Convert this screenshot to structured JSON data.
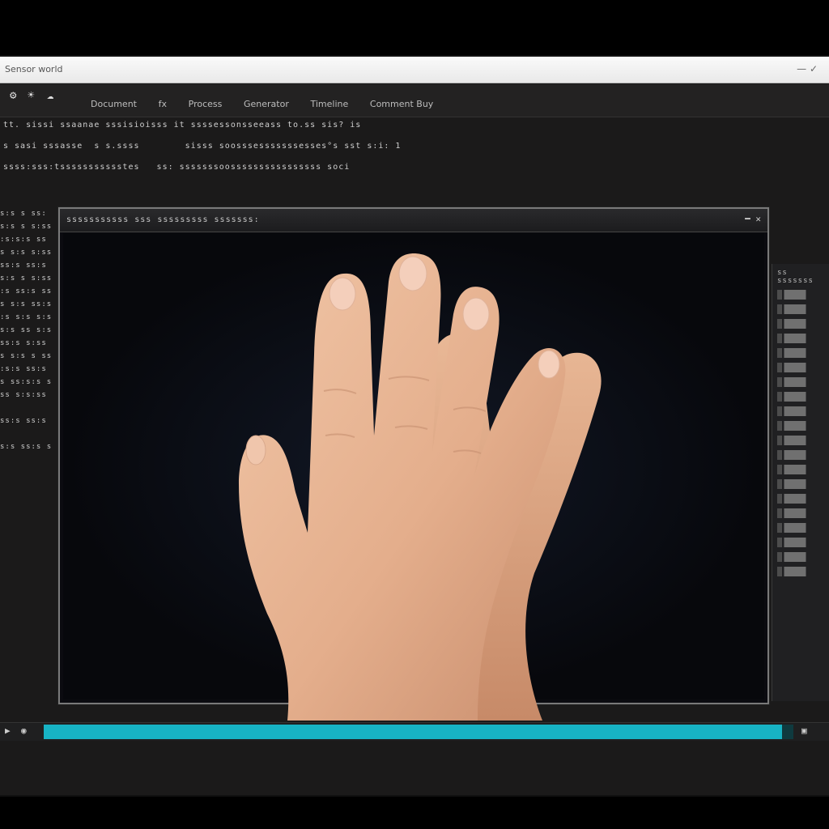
{
  "window": {
    "title": "Sensor world",
    "controls": "—  ✓"
  },
  "toolbar": {
    "icons": [
      "app-icon",
      "gear-icon",
      "cloud-icon"
    ],
    "menu": [
      "Document",
      "fx",
      "Process",
      "Generator",
      "Timeline",
      "Comment Buy"
    ]
  },
  "editor": {
    "line1": "tt. sissi ssaanae sssisioisss it ssssessonsseeass to.ss sis? is",
    "line2": "s sasi sssasse  s s.ssss        sisss soosssesssssssesses°s sst s:i: 1",
    "line3": "ssss:sss:tssssssssssstes   ss: sssssssoossssssssssssssss soci"
  },
  "side_listing": "s:s s ss:\ns:s s s:ss\n:s:s:s ss\ns s:s s:ss\nss:s ss:s\ns:s s s:ss\n:s ss:s ss\ns s:s ss:s\n:s s:s s:s\ns:s ss s:s\nss:s s:ss\ns s:s s ss\n:s:s ss:s\ns ss:s:s s\nss s:s:ss\n\nss:s ss:s\n\ns:s ss:s s",
  "viewer": {
    "title": "sssssssssss sss sssssssss sssssss:",
    "close_label": "━  ✕"
  },
  "right_panel": {
    "header": "ss sssssss"
  },
  "progress": {
    "value": 0.985,
    "accent": "#17b3c4"
  },
  "colors": {
    "background": "#1b1a1a",
    "skin": "#e8b795"
  }
}
